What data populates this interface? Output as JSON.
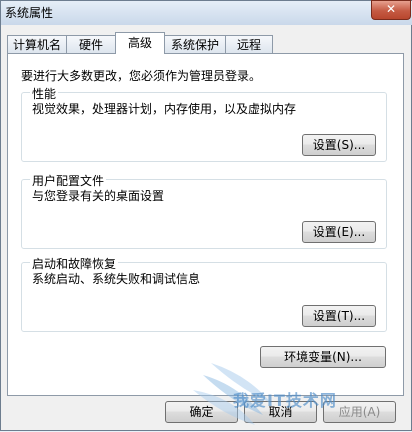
{
  "window": {
    "title": "系统属性",
    "close_symbol": "✕"
  },
  "tabs": [
    {
      "label": "计算机名"
    },
    {
      "label": "硬件"
    },
    {
      "label": "高级"
    },
    {
      "label": "系统保护"
    },
    {
      "label": "远程"
    }
  ],
  "note": "要进行大多数更改，您必须作为管理员登录。",
  "groups": {
    "performance": {
      "title": "性能",
      "desc": "视觉效果，处理器计划，内存使用，以及虚拟内存",
      "button": "设置(S)..."
    },
    "profiles": {
      "title": "用户配置文件",
      "desc": "与您登录有关的桌面设置",
      "button": "设置(E)..."
    },
    "startup": {
      "title": "启动和故障恢复",
      "desc": "系统启动、系统失败和调试信息",
      "button": "设置(T)..."
    }
  },
  "env_button": "环境变量(N)...",
  "footer": {
    "ok": "确定",
    "cancel": "取消",
    "apply": "应用(A)"
  },
  "watermark": "我爱IT技术网"
}
